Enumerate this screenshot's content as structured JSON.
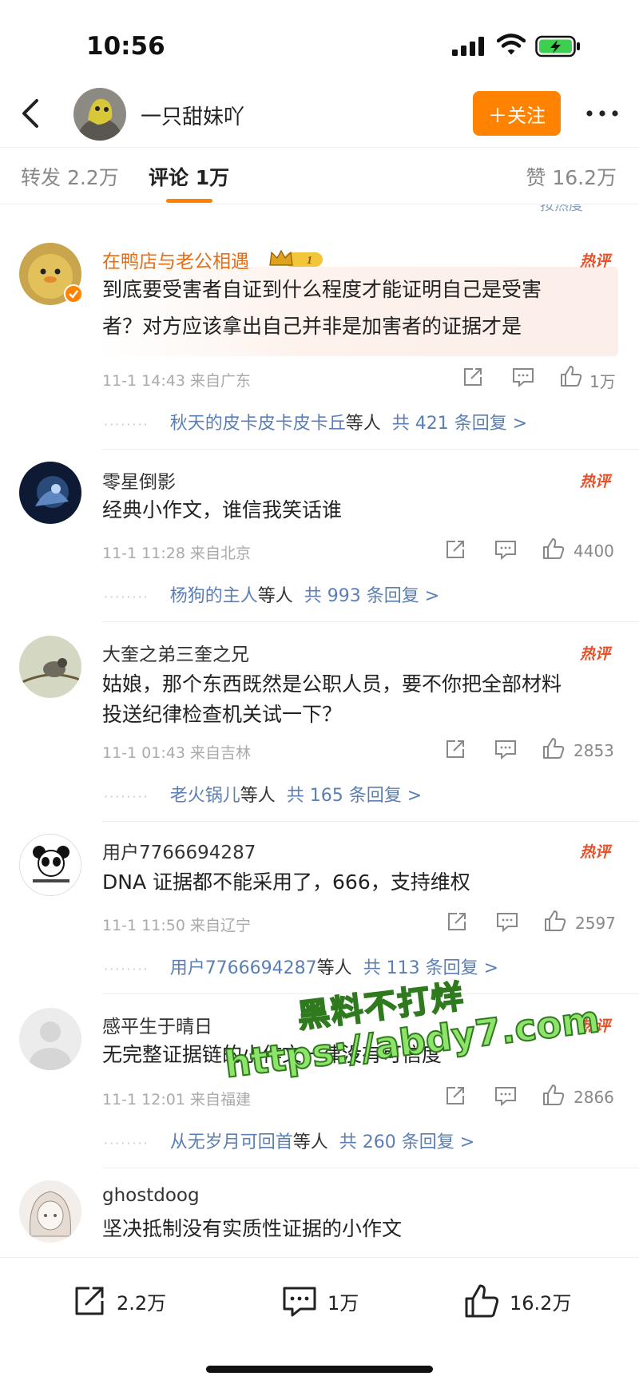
{
  "status_bar": {
    "time": "10:56"
  },
  "header": {
    "name": "一只甜妹吖",
    "follow_label": "＋关注"
  },
  "tabs": {
    "repost": "转发 2.2万",
    "comment": "评论 1万",
    "like": "赞 16.2万"
  },
  "sort_label": "按热度",
  "hot_tag": "热评",
  "comments": [
    {
      "name": "在鸭店与老公相遇",
      "vip_level": "1",
      "text_line1": "到底要受害者自证到什么程度才能证明自己是受害",
      "text_line2": "者？对方应该拿出自己并非是加害者的证据才是",
      "meta": "11-1 14:43 来自广东",
      "likes": "1万",
      "reply_user": "秋天的皮卡皮卡皮卡丘",
      "reply_suffix": "等人",
      "reply_count": "共 421 条回复 >"
    },
    {
      "name": "零星倒影",
      "text_line1": "经典小作文，谁信我笑话谁",
      "meta": "11-1 11:28 来自北京",
      "likes": "4400",
      "reply_user": "杨狗的主人",
      "reply_suffix": "等人",
      "reply_count": "共 993 条回复 >"
    },
    {
      "name": "大奎之弟三奎之兄",
      "text_line1": "姑娘，那个东西既然是公职人员，要不你把全部材料",
      "text_line2": "投送纪律检查机关试一下？",
      "meta": "11-1 01:43 来自吉林",
      "likes": "2853",
      "reply_user": "老火锅儿",
      "reply_suffix": "等人",
      "reply_count": "共 165 条回复 >"
    },
    {
      "name": "用户7766694287",
      "text_line1": "DNA 证据都不能采用了，666，支持维权",
      "meta": "11-1 11:50 来自辽宁",
      "likes": "2597",
      "reply_user": "用户7766694287",
      "reply_suffix": "等人",
      "reply_count": "共 113 条回复 >"
    },
    {
      "name": "感平生于晴日",
      "text_line1": "无完整证据链的小作文一律没有可信度",
      "meta": "11-1 12:01 来自福建",
      "likes": "2866",
      "reply_user": "从无岁月可回首",
      "reply_suffix": "等人",
      "reply_count": "共 260 条回复 >"
    },
    {
      "name": "ghostdoog",
      "text_line1": "坚决抵制没有实质性证据的小作文"
    }
  ],
  "watermark": {
    "line1": "黑料不打烊",
    "line2": "https://abdy7.com"
  },
  "bottom_bar": {
    "repost": "2.2万",
    "comment": "1万",
    "like": "16.2万"
  },
  "colors": {
    "accent": "#ff8200",
    "link": "#5b7fb4",
    "hot": "#e8502a"
  }
}
